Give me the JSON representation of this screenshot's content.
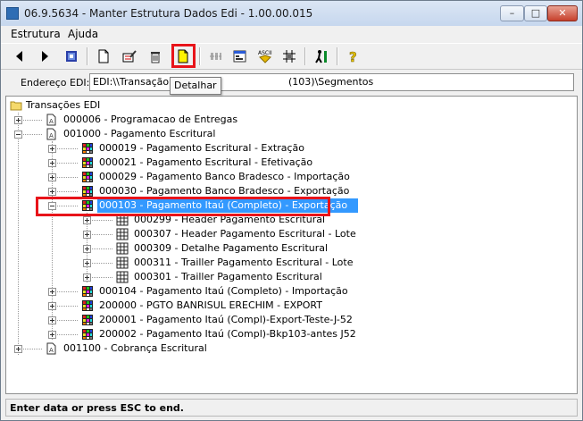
{
  "window": {
    "title": "06.9.5634 - Manter Estrutura Dados Edi - 1.00.00.015"
  },
  "menu": [
    {
      "label": "Estrutura"
    },
    {
      "label": "Ajuda"
    }
  ],
  "toolbar": {
    "tooltip": "Detalhar",
    "buttons": [
      "back-icon",
      "forward-icon",
      "book-icon",
      "new-icon",
      "edit-icon",
      "delete-icon",
      "detail-icon",
      "fields-icon",
      "properties-icon",
      "ascii-icon",
      "grid-icon",
      "exit-icon",
      "help-icon"
    ]
  },
  "address": {
    "label": "Endereço EDI:",
    "value": "EDI:\\\\Transação(10",
    "value_tail": "(103)\\Segmentos"
  },
  "tree": {
    "root": "Transações EDI",
    "items": [
      {
        "text": "000006 - Programacao de Entregas"
      },
      {
        "text": "001000 - Pagamento Escritural"
      },
      {
        "text": "000019 - Pagamento Escritural - Extração"
      },
      {
        "text": "000021 - Pagamento Escritural - Efetivação"
      },
      {
        "text": "000029 - Pagamento Banco Bradesco - Importação"
      },
      {
        "text": "000030 - Pagamento Banco Bradesco - Exportação"
      },
      {
        "text": "000103 - Pagamento Itaú (Completo) - Exportação"
      },
      {
        "text": "000299 - Header Pagamento Escritural"
      },
      {
        "text": "000307 - Header Pagamento Escritural - Lote"
      },
      {
        "text": "000309 - Detalhe Pagamento Escritural"
      },
      {
        "text": "000311 - Trailler Pagamento Escritural - Lote"
      },
      {
        "text": "000301 - Trailler Pagamento Escritural"
      },
      {
        "text": "000104 - Pagamento Itaú (Completo) - Importação"
      },
      {
        "text": "200000 - PGTO BANRISUL ERECHIM - EXPORT"
      },
      {
        "text": "200001 - Pagamento Itaú (Compl)-Export-Teste-J-52"
      },
      {
        "text": "200002 - Pagamento Itaú (Compl)-Bkp103-antes J52"
      },
      {
        "text": "001100 - Cobrança Escritural"
      }
    ]
  },
  "status": {
    "text": "Enter data or press ESC to end."
  },
  "colors": {
    "highlight_box": "#e8141a",
    "selection": "#3399ff"
  }
}
